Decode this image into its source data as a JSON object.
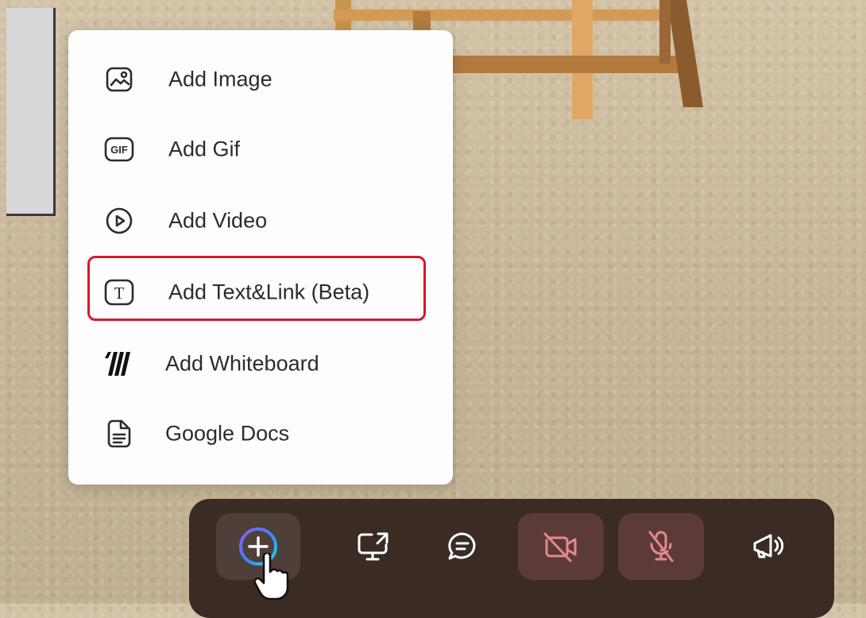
{
  "menu": {
    "items": [
      {
        "label": "Add Image",
        "icon": "image-icon"
      },
      {
        "label": "Add Gif",
        "icon": "gif-icon"
      },
      {
        "label": "Add Video",
        "icon": "play-circle-icon"
      },
      {
        "label": "Add Text&Link (Beta)",
        "icon": "text-icon",
        "highlighted": true
      },
      {
        "label": "Add Whiteboard",
        "icon": "miro-logo-icon"
      },
      {
        "label": "Google Docs",
        "icon": "document-icon"
      }
    ]
  },
  "toolbar": {
    "buttons": [
      {
        "icon": "add-icon",
        "state": "active"
      },
      {
        "icon": "screen-share-icon"
      },
      {
        "icon": "chat-icon"
      },
      {
        "icon": "camera-off-icon",
        "state": "muted"
      },
      {
        "icon": "mic-off-icon",
        "state": "muted"
      },
      {
        "icon": "megaphone-icon"
      }
    ]
  },
  "colors": {
    "highlight": "#d4192b",
    "toolbar_bg": "#3a2c25",
    "muted_icon": "#e38a8f"
  }
}
